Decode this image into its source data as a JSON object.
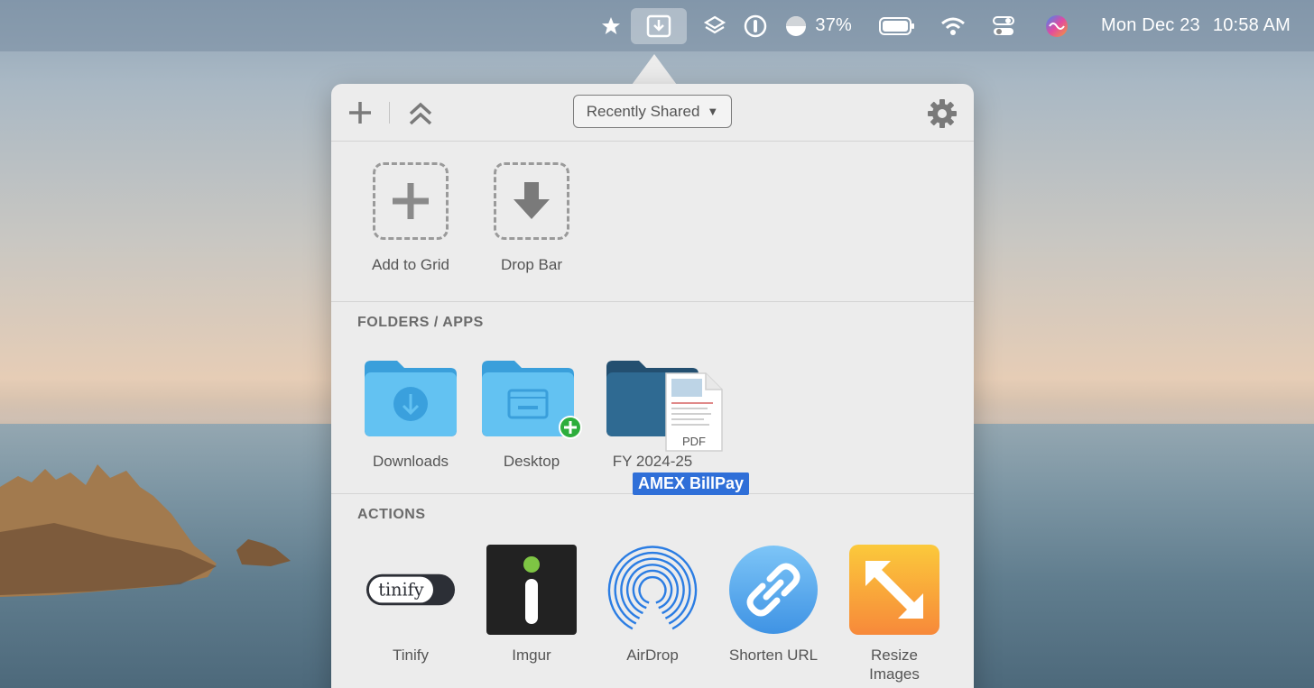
{
  "menubar": {
    "items": [
      {
        "name": "star-icon"
      },
      {
        "name": "dropzone-icon"
      },
      {
        "name": "layers-icon"
      },
      {
        "name": "onepassword-icon"
      },
      {
        "name": "contrast-icon"
      }
    ],
    "brightness_pct": "37%",
    "date": "Mon Dec 23",
    "time": "10:58 AM"
  },
  "toolbar": {
    "dropdown_value": "Recently Shared",
    "dropdown_arrow": "▼"
  },
  "top_slots": [
    {
      "label": "Add to Grid",
      "icon": "plus-icon"
    },
    {
      "label": "Drop Bar",
      "icon": "down-arrow-icon"
    }
  ],
  "folders_section": {
    "title": "FOLDERS / APPS",
    "items": [
      {
        "label": "Downloads",
        "icon": "downloads-folder-icon"
      },
      {
        "label": "Desktop",
        "icon": "desktop-folder-icon"
      },
      {
        "label": "FY 2024-25",
        "icon": "folder-icon"
      }
    ],
    "dragging_file": {
      "type_label": "PDF",
      "name": "AMEX BillPay"
    }
  },
  "actions_section": {
    "title": "ACTIONS",
    "items": [
      {
        "label": "Tinify",
        "icon": "tinify-icon",
        "icon_text": "tinify"
      },
      {
        "label": "Imgur",
        "icon": "imgur-icon"
      },
      {
        "label": "AirDrop",
        "icon": "airdrop-icon"
      },
      {
        "label": "Shorten URL",
        "icon": "link-icon"
      },
      {
        "label": "Resize Images",
        "icon": "resize-icon"
      }
    ]
  },
  "colors": {
    "accent_blue": "#2f6fd8",
    "folder_light": "#5fbff0",
    "folder_dark": "#2f6a92",
    "add_badge": "#2dae3c"
  }
}
